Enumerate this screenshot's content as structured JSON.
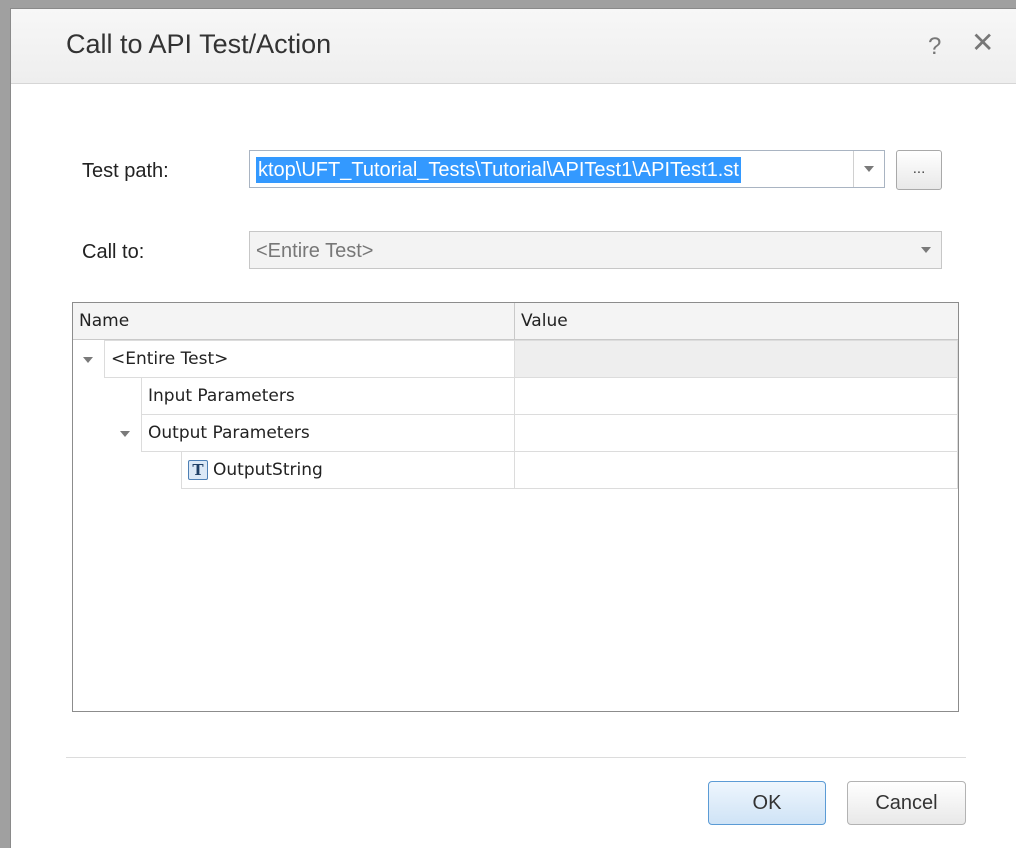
{
  "dialog": {
    "title": "Call to API Test/Action",
    "help_glyph": "?",
    "close_glyph": "✕"
  },
  "form": {
    "test_path_label": "Test path:",
    "test_path_value": "ktop\\UFT_Tutorial_Tests\\Tutorial\\APITest1\\APITest1.st",
    "browse_label": "...",
    "call_to_label": "Call to:",
    "call_to_value": "<Entire Test>"
  },
  "grid": {
    "columns": [
      "Name",
      "Value"
    ],
    "rows": [
      {
        "name": "<Entire Test>",
        "value": "",
        "expandable": true,
        "level": 0
      },
      {
        "name": "Input Parameters",
        "value": "",
        "expandable": false,
        "level": 1
      },
      {
        "name": "Output Parameters",
        "value": "",
        "expandable": true,
        "level": 1
      },
      {
        "name": "OutputString",
        "value": "",
        "expandable": false,
        "level": 2,
        "icon": "text-parameter-icon",
        "icon_glyph": "T"
      }
    ]
  },
  "buttons": {
    "ok": "OK",
    "cancel": "Cancel"
  },
  "colors": {
    "selection": "#3399ff",
    "ok_border": "#5b9bd5"
  }
}
